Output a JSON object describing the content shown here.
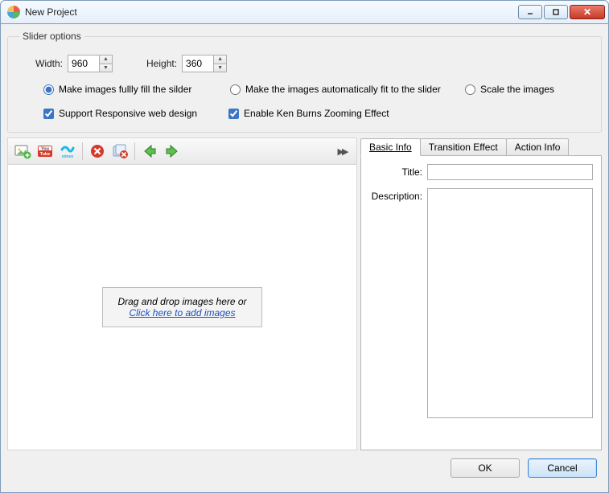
{
  "window": {
    "title": "New Project"
  },
  "group": {
    "legend": "Slider options",
    "width_label": "Width:",
    "height_label": "Height:",
    "width_value": "960",
    "height_value": "360",
    "radio_fill": "Make images fullly fill the silder",
    "radio_autofit": "Make the images automatically fit to the slider",
    "radio_scale": "Scale the images",
    "cb_responsive": "Support Responsive web design",
    "cb_kenburns": "Enable Ken Burns Zooming Effect"
  },
  "toolbar": {
    "icons": {
      "add_image": "add-image-icon",
      "youtube": "youtube-icon",
      "vimeo": "vimeo-icon",
      "delete": "delete-icon",
      "delete_all": "delete-all-icon",
      "prev": "arrow-left-icon",
      "next": "arrow-right-icon",
      "more": "more-icon"
    }
  },
  "dropzone": {
    "line1": "Drag and drop images here or",
    "link": "Click here to add images"
  },
  "tabs": {
    "basic": "Basic Info",
    "transition": "Transition Effect",
    "action": "Action Info"
  },
  "basic_tab": {
    "title_label": "Title:",
    "title_value": "",
    "desc_label": "Description:",
    "desc_value": ""
  },
  "buttons": {
    "ok": "OK",
    "cancel": "Cancel"
  }
}
